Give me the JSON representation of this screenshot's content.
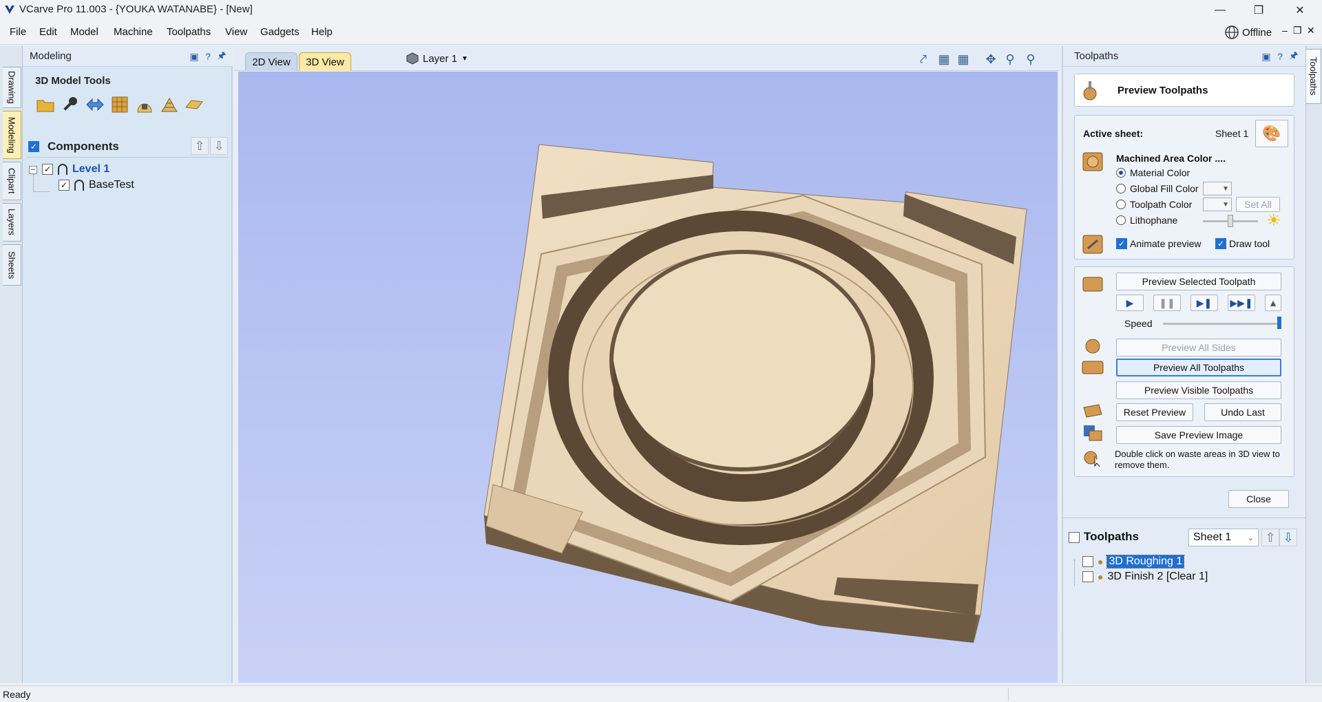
{
  "titlebar": {
    "title": "VCarve Pro 11.003 - {YOUKA WATANABE} - [New]",
    "minimize_icon": "minimize-icon",
    "restore_icon": "restore-icon",
    "close_icon": "close-icon"
  },
  "menubar": {
    "items": [
      "File",
      "Edit",
      "Model",
      "Machine",
      "Toolpaths",
      "View",
      "Gadgets",
      "Help"
    ],
    "offline_label": "Offline"
  },
  "left_tabs": [
    "Drawing",
    "Modeling",
    "Clipart",
    "Layers",
    "Sheets"
  ],
  "left_tabs_active": "Modeling",
  "modeling_panel": {
    "title": "Modeling",
    "tools_title": "3D Model Tools",
    "tools": [
      "import-component-icon",
      "sculpt-icon",
      "move-component-icon",
      "create-texture-icon",
      "bake-component-icon",
      "smooth-icon",
      "slice-icon"
    ],
    "components_label": "Components",
    "tree": {
      "level_label": "Level 1",
      "child_label": "BaseTest"
    }
  },
  "view": {
    "tabs": [
      "2D View",
      "3D View"
    ],
    "active_tab": "3D View",
    "layer_label": "Layer 1"
  },
  "toolpaths_panel": {
    "title": "Toolpaths",
    "preview_title": "Preview Toolpaths",
    "active_sheet_label": "Active sheet:",
    "active_sheet_value": "Sheet 1",
    "machined_area_label": "Machined Area Color ....",
    "color_options": [
      "Material Color",
      "Global Fill Color",
      "Toolpath Color",
      "Lithophane"
    ],
    "selected_color_option": "Material Color",
    "set_all_label": "Set All",
    "animate_preview_label": "Animate preview",
    "draw_tool_label": "Draw tool",
    "preview_selected_label": "Preview Selected Toolpath",
    "speed_label": "Speed",
    "speed_level": 1.0,
    "preview_all_sides_label": "Preview All Sides",
    "preview_all_toolpaths_label": "Preview All Toolpaths",
    "preview_visible_label": "Preview Visible Toolpaths",
    "reset_preview_label": "Reset Preview",
    "undo_last_label": "Undo Last",
    "save_preview_label": "Save Preview Image",
    "hint_text": "Double click on waste areas in 3D view to remove them.",
    "close_label": "Close",
    "list_label": "Toolpaths",
    "sheet_select": "Sheet 1",
    "toolpaths": [
      "3D Roughing 1",
      "3D Finish 2 [Clear 1]"
    ],
    "selected_toolpath": "3D Roughing 1"
  },
  "right_tabs": [
    "Toolpaths"
  ],
  "statusbar": {
    "text": "Ready"
  },
  "colors": {
    "accent": "#1f6fd1",
    "wood": "#e6d1b3",
    "wood_dark": "#6a5640",
    "viewport_top": "#a9b8ef"
  }
}
